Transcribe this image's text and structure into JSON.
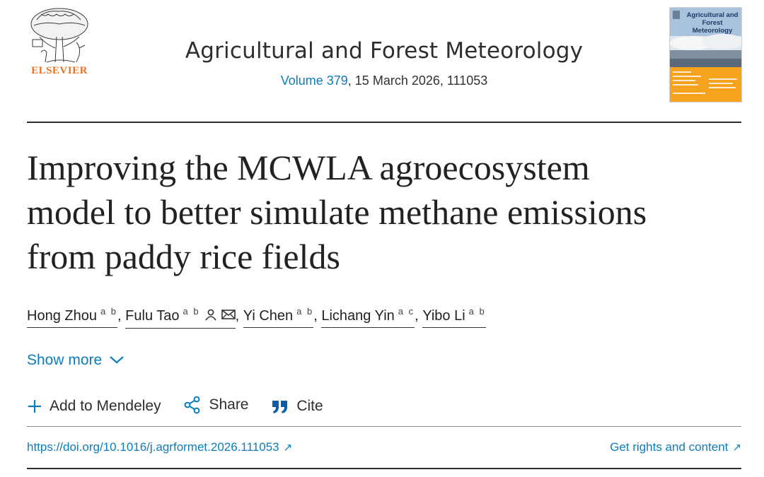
{
  "header": {
    "publisher": "ELSEVIER",
    "journal_title": "Agricultural and Forest Meteorology",
    "volume_link": "Volume 379",
    "issue_rest": ", 15 March 2026, 111053",
    "cover": {
      "title": "Agricultural and Forest Meteorology"
    }
  },
  "article": {
    "title_lines": [
      "Improving the MCWLA agroecosystem",
      "model to better simulate methane emissions",
      "from paddy rice fields"
    ]
  },
  "authors": [
    {
      "name": "Hong Zhou",
      "affil": "a b"
    },
    {
      "name": "Fulu Tao",
      "affil": "a b"
    },
    {
      "name": "Yi Chen",
      "affil": "a b"
    },
    {
      "name": "Lichang Yin",
      "affil": "a c"
    },
    {
      "name": "Yibo Li",
      "affil": "a b"
    }
  ],
  "separators": {
    "comma": ","
  },
  "show_more": "Show more",
  "actions": {
    "mendeley": "Add to Mendeley",
    "share": "Share",
    "cite": "Cite"
  },
  "footer": {
    "doi": "https://doi.org/10.1016/j.agrformet.2026.111053",
    "rights": "Get rights and content",
    "arrow": "↗"
  },
  "colors": {
    "link": "#0c7dbb",
    "elsevier_orange": "#e9711c",
    "cite_icon": "#0c5ea8"
  },
  "icons": [
    "elsevier-tree-logo",
    "person-icon",
    "envelope-icon",
    "chevron-down-icon",
    "plus-icon",
    "share-icon",
    "quote-icon",
    "external-arrow-icon"
  ]
}
